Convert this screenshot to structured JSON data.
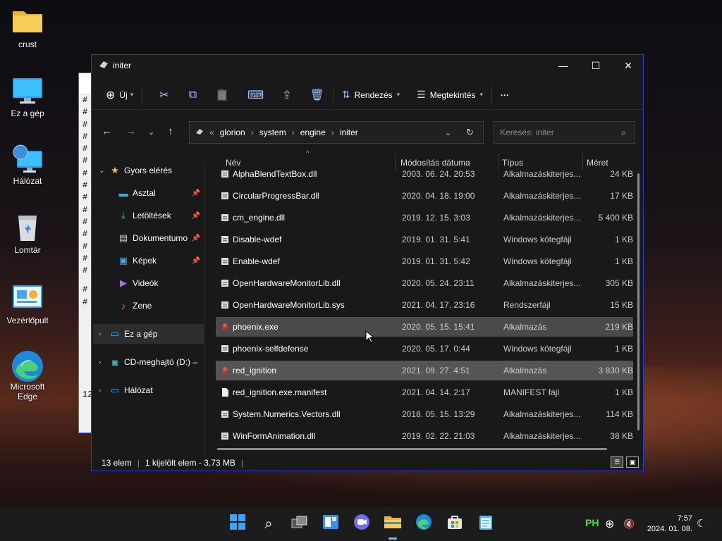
{
  "desktop": {
    "icons": [
      {
        "label": "crust"
      },
      {
        "label": "Ez a gép"
      },
      {
        "label": "Hálózat"
      },
      {
        "label": "Lomtár"
      },
      {
        "label": "Vezérlőpult"
      },
      {
        "label": "Microsoft Edge"
      }
    ]
  },
  "background_window": {
    "hashes": [
      "#",
      "#",
      "#",
      "#",
      "#",
      "#",
      "#",
      "#",
      "#",
      "#",
      "#",
      "#",
      "#",
      "#",
      "#",
      "#",
      "#",
      "#",
      "#"
    ],
    "bottom_number": "12"
  },
  "window": {
    "title": "initer",
    "toolbar": {
      "new_label": "Új",
      "sort_label": "Rendezés",
      "view_label": "Megtekintés",
      "more_label": "···"
    },
    "address": {
      "prefix": "«",
      "crumbs": [
        "glorion",
        "system",
        "engine",
        "initer"
      ]
    },
    "search_placeholder": "Keresés: initer",
    "nav": {
      "quick_access": "Gyors elérés",
      "items": [
        {
          "label": "Asztal"
        },
        {
          "label": "Letöltések"
        },
        {
          "label": "Dokumentumo"
        },
        {
          "label": "Képek"
        },
        {
          "label": "Videók"
        },
        {
          "label": "Zene"
        }
      ],
      "this_pc": "Ez a gép",
      "cd_drive": "CD-meghajtó (D:) –",
      "network": "Hálózat"
    },
    "columns": {
      "name": "Név",
      "date": "Módosítás dátuma",
      "type": "Típus",
      "size": "Méret"
    },
    "files": [
      {
        "name": "AlphaBlendTextBox.dll",
        "date": "2003. 06. 24. 20:53",
        "type": "Alkalmazáskiterjes...",
        "size": "24 KB"
      },
      {
        "name": "CircularProgressBar.dll",
        "date": "2020. 04. 18. 19:00",
        "type": "Alkalmazáskiterjes...",
        "size": "17 KB"
      },
      {
        "name": "cm_engine.dll",
        "date": "2019. 12. 15. 3:03",
        "type": "Alkalmazáskiterjes...",
        "size": "5 400 KB"
      },
      {
        "name": "Disable-wdef",
        "date": "2019. 01. 31. 5:41",
        "type": "Windows kötegfájl",
        "size": "1 KB"
      },
      {
        "name": "Enable-wdef",
        "date": "2019. 01. 31. 5:42",
        "type": "Windows kötegfájl",
        "size": "1 KB"
      },
      {
        "name": "OpenHardwareMonitorLib.dll",
        "date": "2020. 05. 24. 23:11",
        "type": "Alkalmazáskiterjes...",
        "size": "305 KB"
      },
      {
        "name": "OpenHardwareMonitorLib.sys",
        "date": "2021. 04. 17. 23:16",
        "type": "Rendszerfájl",
        "size": "15 KB"
      },
      {
        "name": "phoenix.exe",
        "date": "2020. 05. 15. 15:41",
        "type": "Alkalmazás",
        "size": "219 KB"
      },
      {
        "name": "phoenix-selfdefense",
        "date": "2020. 05. 17. 0:44",
        "type": "Windows kötegfájl",
        "size": "1 KB"
      },
      {
        "name": "red_ignition",
        "date": "2021. 09. 27. 4:51",
        "type": "Alkalmazás",
        "size": "3 830 KB"
      },
      {
        "name": "red_ignition.exe.manifest",
        "date": "2021. 04. 14. 2:17",
        "type": "MANIFEST fájl",
        "size": "1 KB"
      },
      {
        "name": "System.Numerics.Vectors.dll",
        "date": "2018. 05. 15. 13:29",
        "type": "Alkalmazáskiterjes...",
        "size": "114 KB"
      },
      {
        "name": "WinFormAnimation.dll",
        "date": "2019. 02. 22. 21:03",
        "type": "Alkalmazáskiterjes...",
        "size": "38 KB"
      }
    ],
    "status": {
      "count": "13 elem",
      "selection": "1 kijelölt elem - 3,73 MB"
    }
  },
  "taskbar": {
    "time": "7:57",
    "date": "2024. 01. 08.",
    "ime": "PH"
  }
}
